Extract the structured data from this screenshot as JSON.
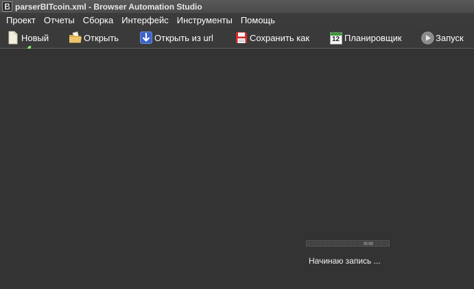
{
  "window": {
    "title": "parserBITcoin.xml - Browser Automation Studio",
    "icon": "bas-app-icon"
  },
  "menu": {
    "items": [
      {
        "label": "Проект"
      },
      {
        "label": "Отчеты"
      },
      {
        "label": "Сборка"
      },
      {
        "label": "Интерфейс"
      },
      {
        "label": "Инструменты"
      },
      {
        "label": "Помощь"
      }
    ]
  },
  "toolbar": {
    "new_label": "Новый",
    "open_label": "Открыть",
    "open_url_label": "Открыть из url",
    "save_as_label": "Сохранить как",
    "scheduler_label": "Планировщик",
    "run_label": "Запуск",
    "scheduler_icon_number": "12",
    "icons": {
      "new": "new-file-icon",
      "open": "open-folder-icon",
      "open_url": "download-arrow-icon",
      "save_as": "floppy-disk-icon",
      "scheduler": "calendar-icon",
      "run": "play-icon"
    }
  },
  "status": {
    "text": "Начинаю запись ...",
    "progress_segments": 16,
    "progress_active": [
      11,
      12
    ]
  },
  "annotation": {
    "arrow_color": "#8cf06c"
  },
  "colors": {
    "background": "#333333",
    "titlebar": "#505050",
    "menubar": "#3b3b3b",
    "toolbar": "#3a3a3a",
    "text": "#ffffff"
  }
}
